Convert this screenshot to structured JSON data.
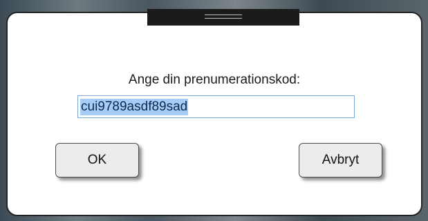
{
  "dialog": {
    "prompt": "Ange din prenumerationskod:",
    "code_value": "cui9789asdf89sad",
    "ok_label": "OK",
    "cancel_label": "Avbryt"
  },
  "colors": {
    "selection": "#a6cdf5",
    "input_border": "#7aa7d9",
    "button_bg": "#ececec",
    "grabber": "#1b1b1b"
  }
}
